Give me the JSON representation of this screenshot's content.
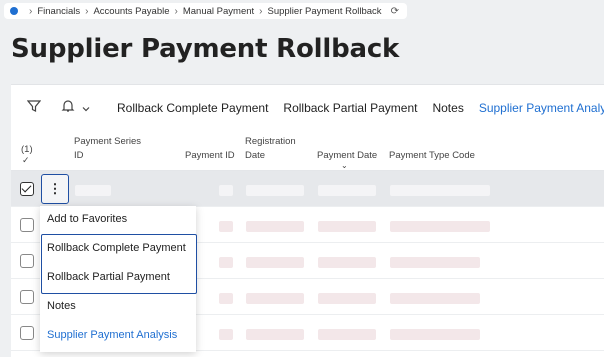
{
  "breadcrumb": {
    "items": [
      "Financials",
      "Accounts Payable",
      "Manual Payment",
      "Supplier Payment Rollback"
    ]
  },
  "page": {
    "title": "Supplier Payment Rollback"
  },
  "toolbar": {
    "actions": [
      "Rollback Complete Payment",
      "Rollback Partial Payment",
      "Notes",
      "Supplier Payment Analysis"
    ]
  },
  "table": {
    "selected_count": "(1)",
    "headers": {
      "payment_series_id_1": "Payment Series",
      "payment_series_id_2": "ID",
      "payment_id": "Payment ID",
      "registration_date_1": "Registration",
      "registration_date_2": "Date",
      "payment_date": "Payment Date",
      "payment_type_code": "Payment Type Code"
    }
  },
  "context_menu": {
    "items": [
      "Add to Favorites",
      "Rollback Complete Payment",
      "Rollback Partial Payment",
      "Notes",
      "Supplier Payment Analysis"
    ]
  },
  "colors": {
    "accent": "#1f6fd1",
    "focus_border": "#1f4fa3"
  }
}
